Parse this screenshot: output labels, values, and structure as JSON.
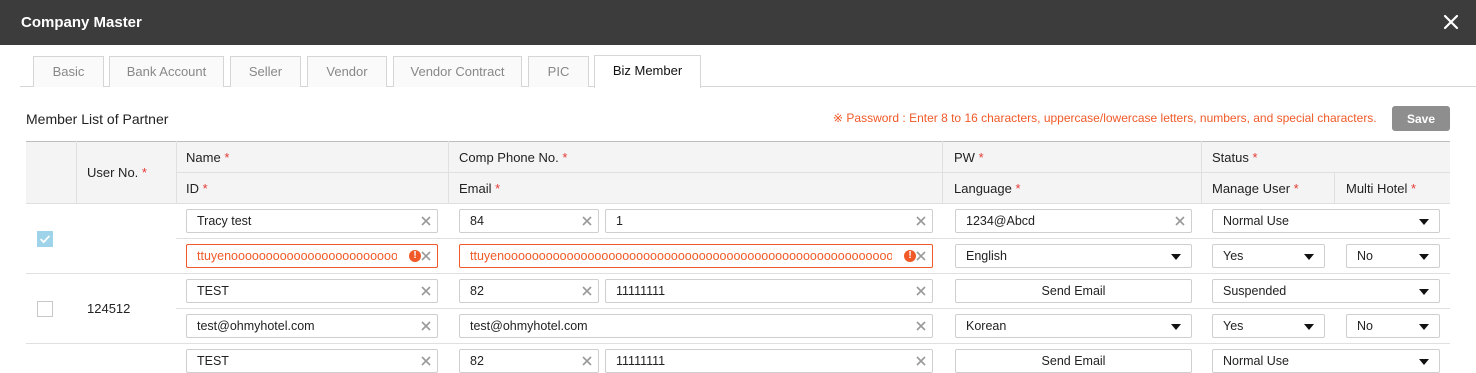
{
  "window": {
    "title": "Company Master"
  },
  "tabs": [
    {
      "label": "Basic"
    },
    {
      "label": "Bank Account"
    },
    {
      "label": "Seller"
    },
    {
      "label": "Vendor"
    },
    {
      "label": "Vendor Contract"
    },
    {
      "label": "PIC"
    },
    {
      "label": "Biz Member"
    }
  ],
  "active_tab": "Biz Member",
  "section": {
    "title": "Member List of Partner",
    "notice": "※ Password : Enter 8 to 16 characters, uppercase/lowercase letters, numbers, and special characters.",
    "save_label": "Save"
  },
  "header": {
    "user_no": "User No.",
    "name": "Name",
    "id": "ID",
    "comp_phone": "Comp Phone No.",
    "email": "Email",
    "pw": "PW",
    "language": "Language",
    "status": "Status",
    "manage_user": "Manage User",
    "multi_hotel": "Multi Hotel",
    "required_mark": "*"
  },
  "rows": [
    {
      "checked": true,
      "user_no": "",
      "name": "Tracy test",
      "id": "ttuyenoooooooooooooooooooooooooooooooooooooooo",
      "id_error": true,
      "phone_code": "84",
      "phone_number": "1",
      "email": "ttuyenoooooooooooooooooooooooooooooooooooooooooooooooooooooooooooooooooooooooooooooooo",
      "email_error": true,
      "pw": "1234@Abcd",
      "language": "English",
      "status": "Normal Use",
      "manage_user": "Yes",
      "multi_hotel": "No"
    },
    {
      "checked": false,
      "user_no": "124512",
      "name": "TEST",
      "id": "test@ohmyhotel.com",
      "id_error": false,
      "phone_code": "82",
      "phone_number": "11111111",
      "email": "test@ohmyhotel.com",
      "email_error": false,
      "pw_button": "Send Email",
      "language": "Korean",
      "status": "Suspended",
      "manage_user": "Yes",
      "multi_hotel": "No"
    },
    {
      "name": "TEST",
      "phone_code": "82",
      "phone_number": "11111111",
      "pw_button": "Send Email",
      "status": "Normal Use"
    }
  ],
  "colors": {
    "titlebar_bg": "#3c3c3c",
    "accent_error": "#f05a28",
    "required": "#e53935",
    "save_button": "#8e8e8e",
    "checkbox_checked": "#9fd3ea"
  },
  "icons": {
    "close": "close-icon",
    "clear": "clear-icon",
    "warning": "warning-icon",
    "dropdown": "chevron-down-icon"
  }
}
